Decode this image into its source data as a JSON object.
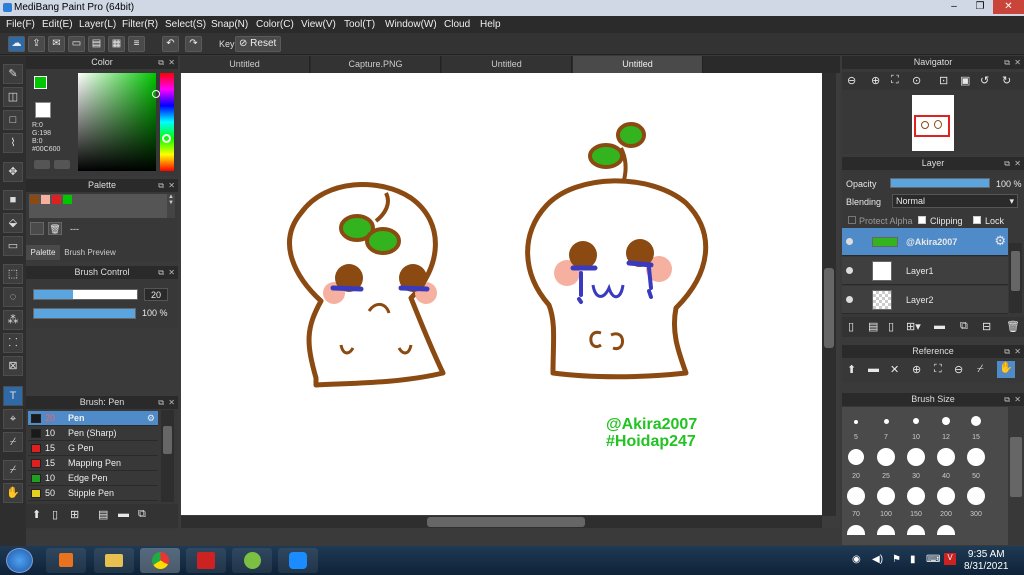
{
  "window": {
    "title": "MediBang Paint Pro (64bit)"
  },
  "menu": [
    "File(F)",
    "Edit(E)",
    "Layer(L)",
    "Filter(R)",
    "Select(S)",
    "Snap(N)",
    "Color(C)",
    "View(V)",
    "Tool(T)",
    "Window(W)",
    "Cloud",
    "Help"
  ],
  "toolbar": {
    "key_label": "Key",
    "reset_label": "Reset"
  },
  "tabs": [
    {
      "label": "Untitled"
    },
    {
      "label": "Capture.PNG"
    },
    {
      "label": "Untitled"
    },
    {
      "label": "Untitled"
    }
  ],
  "color_panel": {
    "title": "Color",
    "r": "R:0",
    "g": "G:198",
    "b": "B:0",
    "hex": "#00C600",
    "accent": "#00C600"
  },
  "palette_panel": {
    "title": "Palette",
    "dash": "---",
    "tab_palette": "Palette",
    "tab_preview": "Brush Preview"
  },
  "brush_control": {
    "title": "Brush Control",
    "size": "20",
    "opacity": "100 %"
  },
  "brush_list": {
    "title": "Brush: Pen",
    "items": [
      {
        "size": "20",
        "name": "Pen",
        "color": "#1a1a1a"
      },
      {
        "size": "10",
        "name": "Pen (Sharp)",
        "color": "#1a1a1a"
      },
      {
        "size": "15",
        "name": "G Pen",
        "color": "#e02020"
      },
      {
        "size": "15",
        "name": "Mapping Pen",
        "color": "#e02020"
      },
      {
        "size": "10",
        "name": "Edge Pen",
        "color": "#20a020"
      },
      {
        "size": "50",
        "name": "Stipple Pen",
        "color": "#e8d020"
      }
    ]
  },
  "navigator": {
    "title": "Navigator"
  },
  "layer_panel": {
    "title": "Layer",
    "opacity_label": "Opacity",
    "opacity_value": "100 %",
    "blending_label": "Blending",
    "blending_value": "Normal",
    "protect_alpha": "Protect Alpha",
    "clipping": "Clipping",
    "lock": "Lock",
    "layers": [
      {
        "name": "@Akira2007"
      },
      {
        "name": "Layer1"
      },
      {
        "name": "Layer2"
      }
    ]
  },
  "reference": {
    "title": "Reference"
  },
  "brush_size": {
    "title": "Brush Size",
    "sizes": [
      "5",
      "7",
      "10",
      "12",
      "15",
      "20",
      "25",
      "30",
      "40",
      "50",
      "70",
      "100",
      "150",
      "200",
      "300"
    ]
  },
  "canvas_text": {
    "line1": "@Akira2007",
    "line2": "#Hoidap247"
  },
  "clock": {
    "time": "9:35 AM",
    "date": "8/31/2021"
  }
}
